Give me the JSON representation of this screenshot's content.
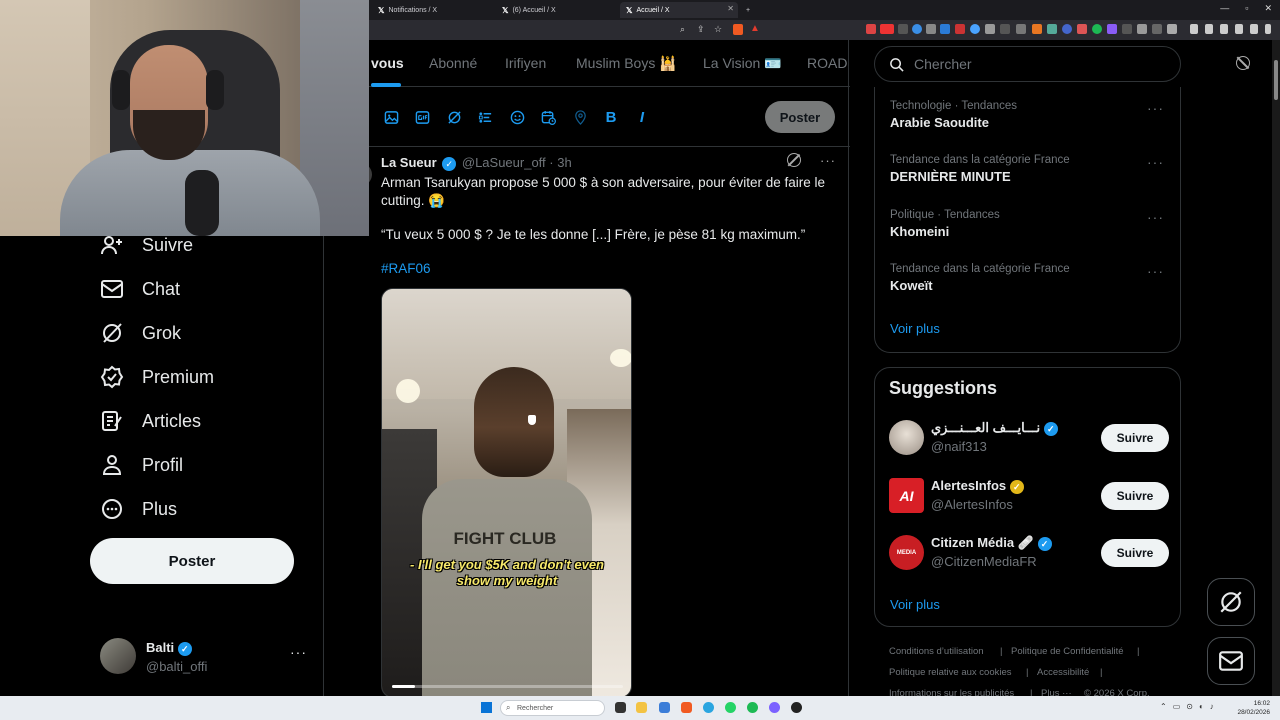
{
  "browser": {
    "tabs": [
      {
        "label": "Notifications / X",
        "active": false
      },
      {
        "label": "(6) Accueil / X",
        "active": false
      },
      {
        "label": "Accueil / X",
        "active": true
      }
    ],
    "new_tab": "+"
  },
  "nav": {
    "items": [
      {
        "label": "Suivre",
        "icon": "follow-icon"
      },
      {
        "label": "Chat",
        "icon": "mail-icon"
      },
      {
        "label": "Grok",
        "icon": "grok-icon"
      },
      {
        "label": "Premium",
        "icon": "verified-icon"
      },
      {
        "label": "Articles",
        "icon": "article-icon"
      },
      {
        "label": "Profil",
        "icon": "profile-icon"
      },
      {
        "label": "Plus",
        "icon": "more-icon"
      }
    ],
    "post_label": "Poster",
    "account": {
      "name": "Balti",
      "handle": "@balti_offi"
    }
  },
  "feed": {
    "tabs": [
      "vous",
      "Abonné",
      "Irifiyen",
      "Muslim Boys 🕌",
      "La Vision 🪪",
      "ROAD"
    ],
    "compose_post": "Poster",
    "compose_tools": [
      "image-icon",
      "gif-icon",
      "grok-icon",
      "poll-icon",
      "emoji-icon",
      "schedule-icon",
      "location-icon",
      "bold-icon",
      "italic-icon"
    ],
    "tweet": {
      "author": "La Sueur",
      "handle": "@LaSueur_off",
      "time": "· 3h",
      "line1": "Arman Tsarukyan propose 5 000 $ à son adversaire, pour éviter de faire le cutting. 😭",
      "line2": "“Tu veux 5 000 $ ? Je te les donne [...] Frère, je pèse 81 kg maximum.”",
      "hashtag": "#RAF06",
      "video_caption": "- I'll get you $5K and don't even show my weight",
      "shirt_text": "FIGHT CLUB"
    }
  },
  "sidebar": {
    "search_placeholder": "Chercher",
    "trends": [
      {
        "meta": "Technologie · Tendances",
        "name": "Arabie Saoudite"
      },
      {
        "meta": "Tendance dans la catégorie France",
        "name": "DERNIÈRE MINUTE"
      },
      {
        "meta": "Politique · Tendances",
        "name": "Khomeini"
      },
      {
        "meta": "Tendance dans la catégorie France",
        "name": "Koweït"
      }
    ],
    "trends_more": "Voir plus",
    "suggestions_title": "Suggestions",
    "suggestions": [
      {
        "name": "نـــايـــف العـــنـــزي",
        "handle": "@naif313",
        "button": "Suivre",
        "badge": "blue"
      },
      {
        "name": "AlertesInfos",
        "handle": "@AlertesInfos",
        "button": "Suivre",
        "badge": "gold"
      },
      {
        "name": "Citizen Média 🩹",
        "handle": "@CitizenMediaFR",
        "button": "Suivre",
        "badge": "blue"
      }
    ],
    "suggestions_more": "Voir plus",
    "footer": [
      "Conditions d’utilisation",
      "|",
      "Politique de Confidentialité",
      "|",
      "Politique relative aux cookies",
      "|",
      "Accessibilité",
      "|",
      "Informations sur les publicités",
      "|",
      "Plus ···",
      "© 2026 X Corp."
    ]
  },
  "taskbar": {
    "search_placeholder": "Rechercher",
    "time": "16:02",
    "date": "28/02/2026"
  },
  "colors": {
    "accent": "#1d9bf0",
    "gold_badge": "#e2b719",
    "background": "#000000",
    "border": "#2f3336",
    "muted": "#71767b"
  }
}
